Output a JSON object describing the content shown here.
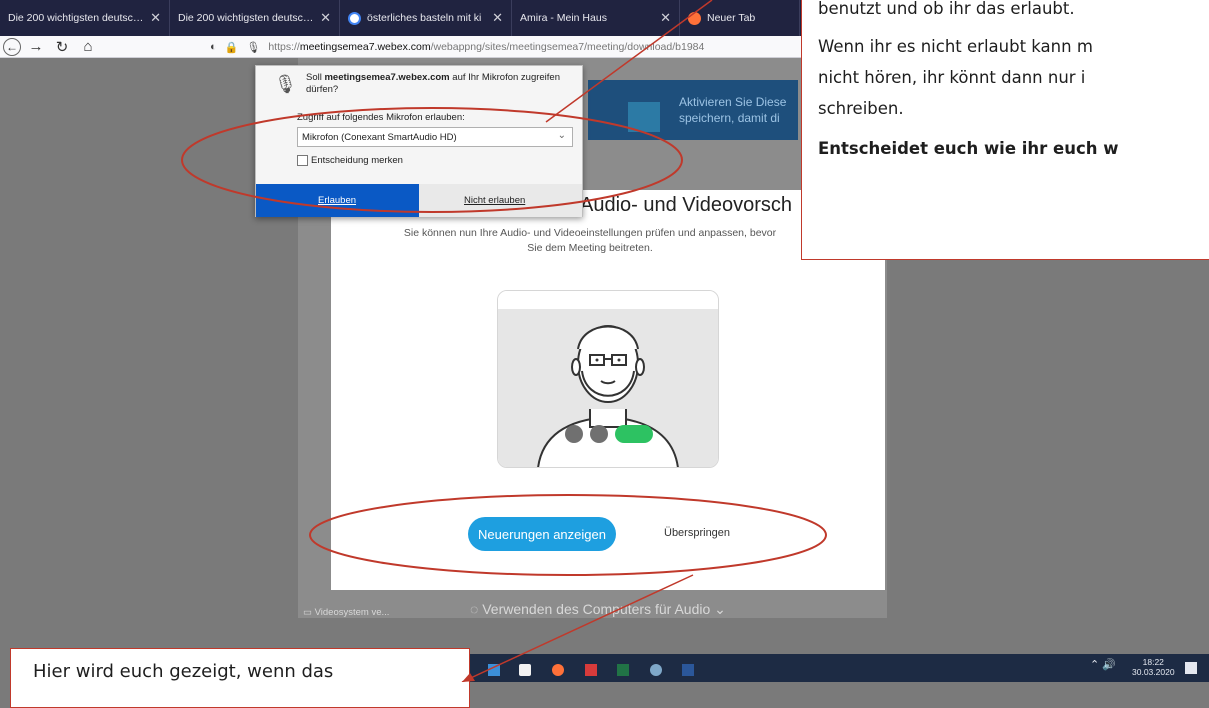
{
  "browser": {
    "tabs": [
      {
        "title": "Die 200 wichtigsten deutsche",
        "close": "✕"
      },
      {
        "title": "Die 200 wichtigsten deutsche",
        "close": "✕"
      },
      {
        "title": "österliches basteln mit ki",
        "close": "✕"
      },
      {
        "title": "Amira - Mein Haus",
        "close": "✕"
      },
      {
        "title": "Neuer Tab",
        "close": "✕"
      }
    ],
    "url_prefix": "https://",
    "url_domain": "meetingsemea7.webex.com",
    "url_rest": "/webappng/sites/meetingsemea7/meeting/download/b1984"
  },
  "mic_popup": {
    "question_pre": "Soll ",
    "question_domain": "meetingsemea7.webex.com",
    "question_post": " auf Ihr Mikrofon zugreifen dürfen?",
    "device_label": "Zugriff auf folgendes Mikrofon erlauben:",
    "device_value": "Mikrofon (Conexant SmartAudio HD)",
    "remember_label": "Entscheidung merken",
    "allow_label": "Erlauben",
    "deny_label": "Nicht erlauben"
  },
  "webex": {
    "promo_text_line1": "Aktivieren Sie Diese",
    "promo_text_line2": "speichern, damit di",
    "title": "Audio- und Videovorsch",
    "description": "Sie können nun Ihre Audio- und Videoeinstellungen prüfen und anpassen, bevor Sie dem Meeting beitreten.",
    "primary_button": "Neuerungen anzeigen",
    "skip_link": "Überspringen",
    "video_system": "Videosystem ve...",
    "audio_option": "Verwenden des Computers für Audio"
  },
  "annotations": {
    "top_right_line1": "benutzt und ob ihr das erlaubt.",
    "top_right_line2a": "Wenn ihr es nicht erlaubt kann m",
    "top_right_line2b": "nicht hören, ihr könnt dann nur i",
    "top_right_line2c": "schreiben.",
    "top_right_bold": "Entscheidet euch wie ihr euch w",
    "bottom_left": "Hier wird euch gezeigt, wenn das"
  },
  "taskbar": {
    "time": "18:22",
    "date": "30.03.2020"
  },
  "colors": {
    "accent_red": "#c0392b",
    "webex_blue": "#1e9fe0",
    "firefox_allow": "#0a59c5",
    "toggle_green": "#2dc262"
  }
}
